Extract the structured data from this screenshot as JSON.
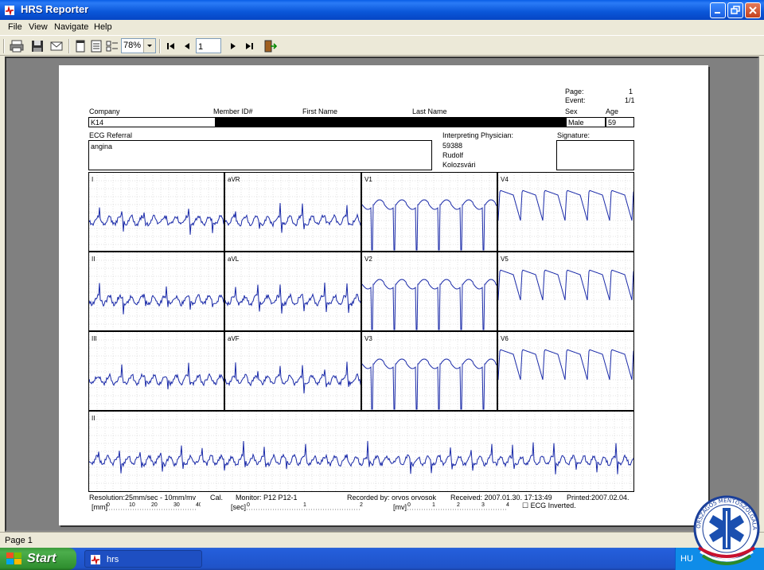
{
  "window": {
    "title": "HRS Reporter"
  },
  "menu": [
    "File",
    "View",
    "Navigate",
    "Help"
  ],
  "toolbar": {
    "zoom": "78%",
    "page": "1"
  },
  "status": {
    "text": "Page 1"
  },
  "taskbar": {
    "start": "Start",
    "task": "hrs",
    "tray": "HU"
  },
  "report": {
    "page_label": "Page:",
    "page_value": "1",
    "event_label": "Event:",
    "event_value": "1/1",
    "company_label": "Company",
    "member_label": "Member ID#",
    "first_label": "First Name",
    "last_label": "Last Name",
    "sex_label": "Sex",
    "age_label": "Age",
    "company": "K14",
    "sex": "Male",
    "age": "59",
    "referral_label": "ECG Referral",
    "referral": "angina",
    "physician_label": "Interpreting Physician:",
    "physician_lines": [
      "59388",
      "Rudolf",
      "Kolozsvári"
    ],
    "signature_label": "Signature:",
    "leads": [
      "I",
      "aVR",
      "V1",
      "V4",
      "II",
      "aVL",
      "V2",
      "V5",
      "III",
      "aVF",
      "V3",
      "V6"
    ],
    "rhythm_lead": "II",
    "footer": {
      "resolution": "Resolution:25mm/sec - 10mm/mv",
      "cal": "Cal.",
      "monitor": "Monitor: P12 P12-1",
      "recorded": "Recorded by: orvos orvosok",
      "received": "Received:  2007.01.30. 17:13:49",
      "printed": "Printed:2007.02.04.",
      "mm_label": "[mm]",
      "mm_ticks": [
        "0",
        "10",
        "20",
        "30",
        "40"
      ],
      "sec_label": "[sec]",
      "sec_ticks": [
        "0",
        "1",
        "2"
      ],
      "mv_label": "[mv]",
      "mv_ticks": [
        "0",
        "1",
        "2",
        "3",
        "4"
      ],
      "inverted": "ECG Inverted."
    }
  },
  "colors": {
    "trace": "#1a2aa8",
    "grid": "#b8b8b8",
    "title_blue": "#0a56d8"
  },
  "logo": {
    "text": "ORSZÁGOS MENTŐSZOLGÁLAT"
  }
}
